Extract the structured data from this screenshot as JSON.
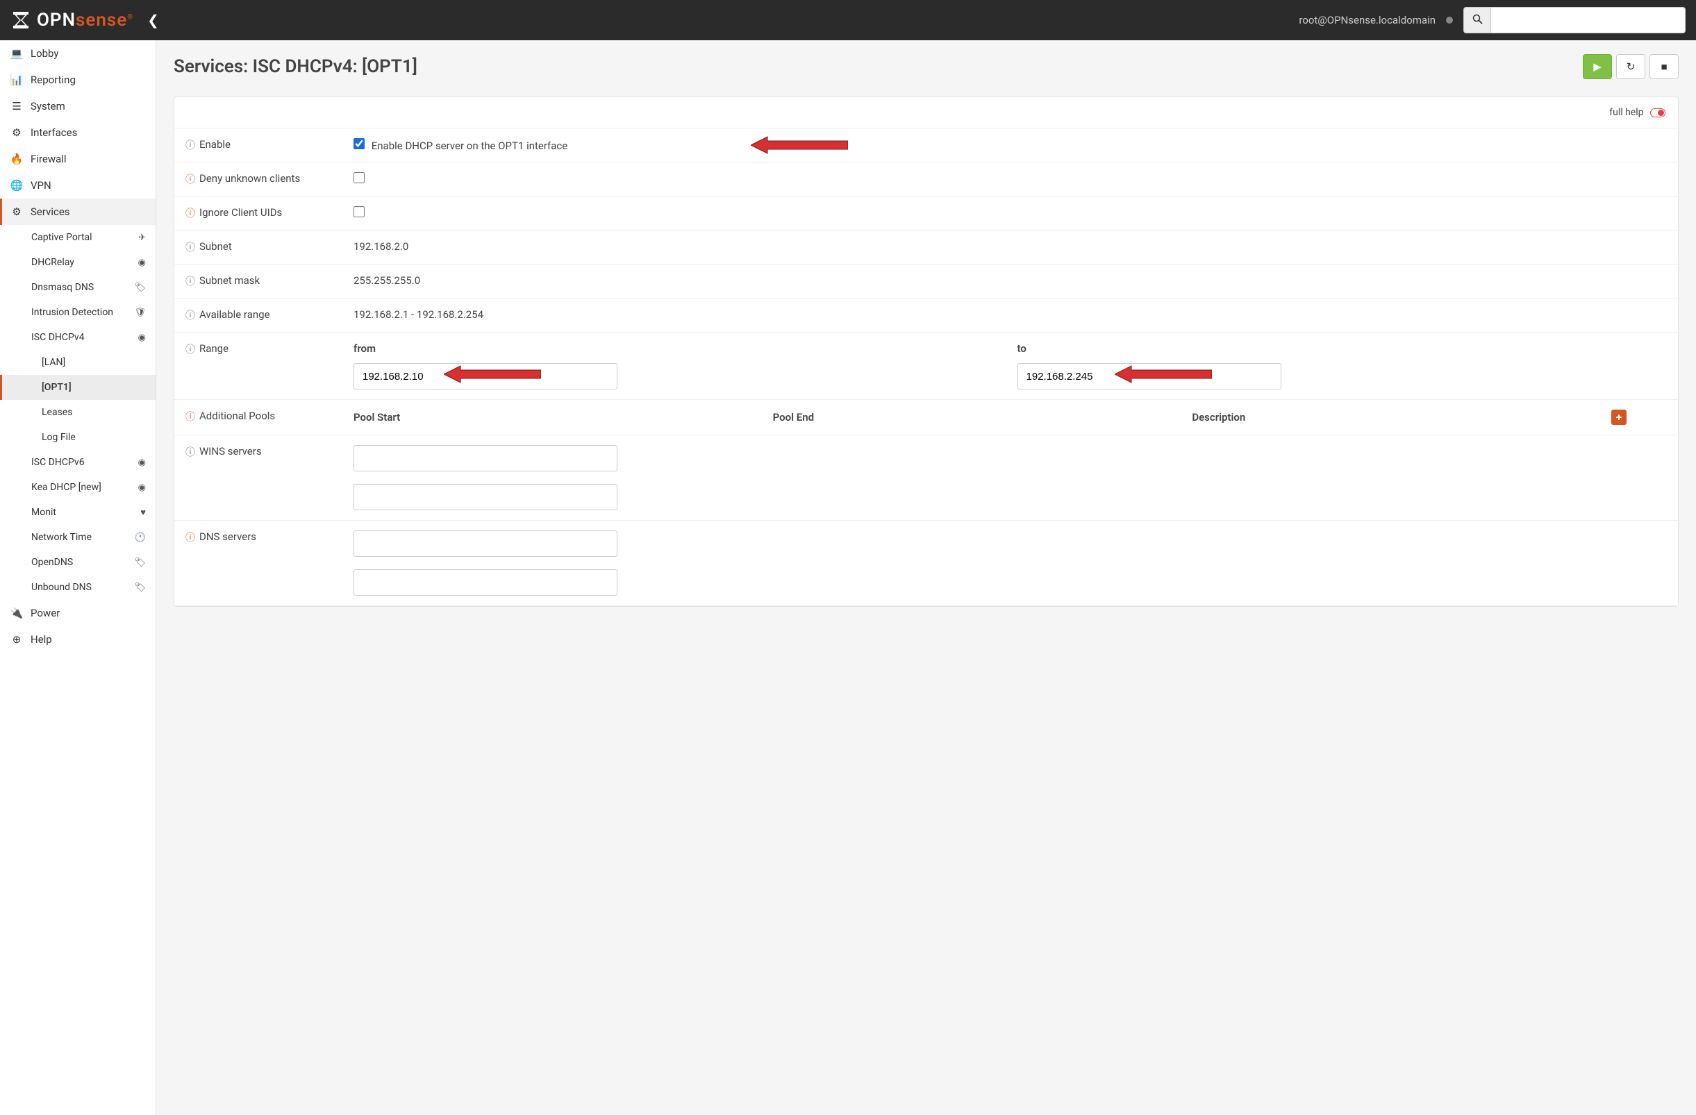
{
  "header": {
    "user": "root@OPNsense.localdomain",
    "logo_opn": "OPN",
    "logo_sense": "sense"
  },
  "sidebar": {
    "items": [
      {
        "icon": "laptop",
        "label": "Lobby"
      },
      {
        "icon": "chart",
        "label": "Reporting"
      },
      {
        "icon": "bars",
        "label": "System"
      },
      {
        "icon": "sitemap",
        "label": "Interfaces"
      },
      {
        "icon": "fire",
        "label": "Firewall"
      },
      {
        "icon": "globe",
        "label": "VPN"
      },
      {
        "icon": "gear",
        "label": "Services",
        "active": true
      }
    ],
    "services_sub": [
      {
        "label": "Captive Portal",
        "ricon": "send"
      },
      {
        "label": "DHCRelay",
        "ricon": "dot"
      },
      {
        "label": "Dnsmasq DNS",
        "ricon": "tag"
      },
      {
        "label": "Intrusion Detection",
        "ricon": "shield"
      },
      {
        "label": "ISC DHCPv4",
        "ricon": "dot",
        "expanded": true
      },
      {
        "label": "ISC DHCPv6",
        "ricon": "dot"
      },
      {
        "label": "Kea DHCP [new]",
        "ricon": "dot"
      },
      {
        "label": "Monit",
        "ricon": "heart"
      },
      {
        "label": "Network Time",
        "ricon": "clock"
      },
      {
        "label": "OpenDNS",
        "ricon": "tag"
      },
      {
        "label": "Unbound DNS",
        "ricon": "tag"
      }
    ],
    "dhcp_sub": [
      {
        "label": "[LAN]"
      },
      {
        "label": "[OPT1]",
        "active": true
      },
      {
        "label": "Leases"
      },
      {
        "label": "Log File"
      }
    ],
    "footer": [
      {
        "icon": "plug",
        "label": "Power"
      },
      {
        "icon": "life-ring",
        "label": "Help"
      }
    ]
  },
  "page": {
    "title": "Services: ISC DHCPv4: [OPT1]",
    "full_help": "full help"
  },
  "form": {
    "enable": {
      "label": "Enable",
      "text": "Enable DHCP server on the OPT1 interface",
      "checked": true
    },
    "deny_unknown": {
      "label": "Deny unknown clients",
      "checked": false
    },
    "ignore_uids": {
      "label": "Ignore Client UIDs",
      "checked": false
    },
    "subnet": {
      "label": "Subnet",
      "value": "192.168.2.0"
    },
    "subnet_mask": {
      "label": "Subnet mask",
      "value": "255.255.255.0"
    },
    "available_range": {
      "label": "Available range",
      "value": "192.168.2.1 - 192.168.2.254"
    },
    "range": {
      "label": "Range",
      "from_label": "from",
      "to_label": "to",
      "from": "192.168.2.10",
      "to": "192.168.2.245"
    },
    "additional_pools": {
      "label": "Additional Pools",
      "col_start": "Pool Start",
      "col_end": "Pool End",
      "col_desc": "Description"
    },
    "wins": {
      "label": "WINS servers"
    },
    "dns": {
      "label": "DNS servers"
    }
  }
}
